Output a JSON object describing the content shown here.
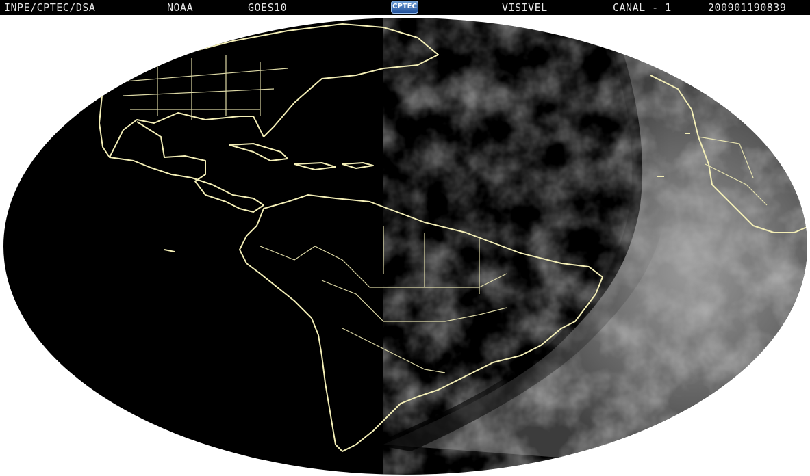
{
  "header": {
    "organization": "INPE/CPTEC/DSA",
    "agency": "NOAA",
    "satellite": "GOES10",
    "logo": "CPTEC",
    "band": "VISIVEL",
    "channel": "CANAL - 1",
    "timestamp": "200901190839"
  },
  "colors": {
    "background": "#ffffff",
    "header_bg": "#000000",
    "header_text": "#e8e8e8",
    "earth_night": "#000000",
    "coastline": "#f3eeb6",
    "clouds_day": "#8a8a8a"
  },
  "map": {
    "projection": "full-disk elliptical",
    "regions": [
      "North America",
      "Central America",
      "Caribbean",
      "South America",
      "Atlantic Ocean",
      "West Africa"
    ],
    "lighting": "terminator with daylight on east (Africa / South Atlantic)"
  }
}
